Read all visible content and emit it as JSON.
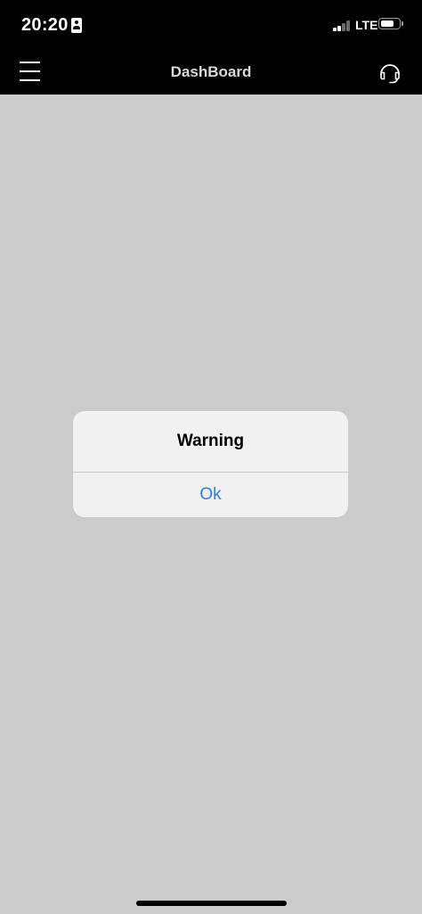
{
  "status_bar": {
    "time": "20:20",
    "network": "LTE",
    "signal_bars_active": 2,
    "signal_bars_total": 4,
    "battery_level": 0.75,
    "icons": [
      "contact-card-icon",
      "signal-icon",
      "battery-icon"
    ]
  },
  "nav_bar": {
    "title": "DashBoard",
    "left_icon": "menu-icon",
    "right_icon": "headset-support-icon"
  },
  "alert": {
    "title": "Warning",
    "button_label": "Ok"
  },
  "colors": {
    "header_background": "#000000",
    "content_background": "#cbcbcb",
    "dialog_background": "#f1f1f1",
    "link_blue": "#2f7fd3",
    "signal_active": "#ffffff",
    "signal_inactive": "#6a6a6a"
  }
}
